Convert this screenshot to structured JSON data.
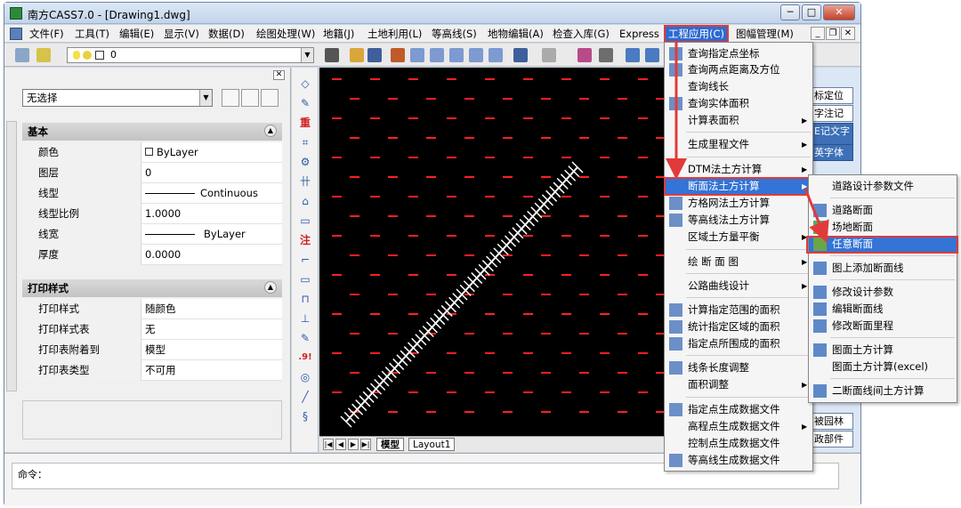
{
  "window": {
    "title": "南方CASS7.0 - [Drawing1.dwg]",
    "minimize": "─",
    "restore": "□",
    "close": "✕"
  },
  "menubar": {
    "items": [
      "文件(F)",
      "工具(T)",
      "编辑(E)",
      "显示(V)",
      "数据(D)",
      "绘图处理(W)",
      "地籍(J)",
      "土地利用(L)",
      "等高线(S)",
      "地物编辑(A)",
      "检查入库(G)",
      "Express",
      "工程应用(C)",
      "图幅管理(M)"
    ],
    "doc_min": "_",
    "doc_restore": "❐",
    "doc_close": "✕"
  },
  "toolbar": {
    "layer_value": "0"
  },
  "properties": {
    "selection": "无选择",
    "section_basic": "基本",
    "basic_rows": [
      {
        "name": "颜色",
        "value": "ByLayer"
      },
      {
        "name": "图层",
        "value": "0"
      },
      {
        "name": "线型",
        "value": "Continuous"
      },
      {
        "name": "线型比例",
        "value": "1.0000"
      },
      {
        "name": "线宽",
        "value": "ByLayer"
      },
      {
        "name": "厚度",
        "value": "0.0000"
      }
    ],
    "section_print": "打印样式",
    "print_rows": [
      {
        "name": "打印样式",
        "value": "随颜色"
      },
      {
        "name": "打印样式表",
        "value": "无"
      },
      {
        "name": "打印表附着到",
        "value": "模型"
      },
      {
        "name": "打印表类型",
        "value": "不可用"
      }
    ]
  },
  "vtoolbar": {
    "labels": [
      "重",
      "注",
      ".9!"
    ]
  },
  "canvas": {
    "background": "#000000",
    "points_color": "#ff2020",
    "line_color": "#ffffff"
  },
  "tabs": {
    "model": "模型",
    "layout": "Layout1"
  },
  "command": {
    "prompt": "命令："
  },
  "right_panel": {
    "items": [
      "标定位",
      "字注记",
      "E记文字",
      "英字体",
      "被园林",
      "政部件"
    ]
  },
  "engineering_menu": {
    "items": [
      "查询指定点坐标",
      "查询两点距离及方位",
      "查询线长",
      "查询实体面积",
      "计算表面积",
      "生成里程文件",
      "DTM法土方计算",
      "断面法土方计算",
      "方格网法土方计算",
      "等高线法土方计算",
      "区域土方量平衡",
      "绘 断 面 图",
      "公路曲线设计",
      "计算指定范围的面积",
      "统计指定区域的面积",
      "指定点所围成的面积",
      "线条长度调整",
      "面积调整",
      "指定点生成数据文件",
      "高程点生成数据文件",
      "控制点生成数据文件",
      "等高线生成数据文件"
    ]
  },
  "section_submenu": {
    "items": [
      "道路设计参数文件",
      "道路断面",
      "场地断面",
      "任意断面",
      "图上添加断面线",
      "修改设计参数",
      "编辑断面线",
      "修改断面里程",
      "图面土方计算",
      "图面土方计算(excel)",
      "二断面线间土方计算"
    ]
  },
  "colors": {
    "accent": "#3374d6",
    "highlight_box": "#e23a3a",
    "arrow": "#e23a3a"
  }
}
